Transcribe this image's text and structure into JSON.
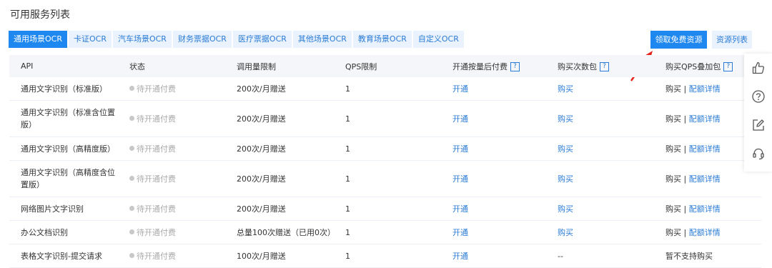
{
  "page": {
    "title": "可用服务列表"
  },
  "tabs": [
    "通用场景OCR",
    "卡证OCR",
    "汽车场景OCR",
    "财务票据OCR",
    "医疗票据OCR",
    "其他场景OCR",
    "教育场景OCR",
    "自定义OCR"
  ],
  "buttons": {
    "free_resources": "领取免费资源",
    "resource_list": "资源列表"
  },
  "table": {
    "headers": {
      "api": "API",
      "status": "状态",
      "quota": "调用量限制",
      "qps": "QPS限制",
      "pay_after": "开通按量后付费",
      "buy_pack": "购买次数包",
      "buy_qps": "购买QPS叠加包"
    },
    "help_mark": "?",
    "rows": [
      {
        "api": "通用文字识别（标准版）",
        "status": "待开通付费",
        "quota": "200次/月赠送",
        "qps": "1",
        "open": "开通",
        "buy": "购买",
        "buy_qps": "购买",
        "sep": "|",
        "detail": "配额详情"
      },
      {
        "api": "通用文字识别（标准含位置版）",
        "status": "待开通付费",
        "quota": "200次/月赠送",
        "qps": "1",
        "open": "开通",
        "buy": "购买",
        "buy_qps": "购买",
        "sep": "|",
        "detail": "配额详情"
      },
      {
        "api": "通用文字识别（高精度版）",
        "status": "待开通付费",
        "quota": "200次/月赠送",
        "qps": "1",
        "open": "开通",
        "buy": "购买",
        "buy_qps": "购买",
        "sep": "|",
        "detail": "配额详情"
      },
      {
        "api": "通用文字识别（高精度含位置版）",
        "status": "待开通付费",
        "quota": "200次/月赠送",
        "qps": "1",
        "open": "开通",
        "buy": "购买",
        "buy_qps": "购买",
        "sep": "|",
        "detail": "配额详情"
      },
      {
        "api": "网络图片文字识别",
        "status": "待开通付费",
        "quota": "200次/月赠送",
        "qps": "1",
        "open": "开通",
        "buy": "购买",
        "buy_qps": "购买",
        "sep": "|",
        "detail": "配额详情"
      },
      {
        "api": "办公文档识别",
        "status": "待开通付费",
        "quota": "总量100次赠送（已用0次）",
        "qps": "1",
        "open": "开通",
        "buy": "购买",
        "buy_qps": "购买",
        "sep": "|",
        "detail": "配额详情"
      },
      {
        "api": "表格文字识别-提交请求",
        "status": "待开通付费",
        "quota": "100次/月赠送",
        "qps": "1",
        "open": "开通",
        "buy": "--",
        "buy_qps": "暂不支持购买"
      }
    ]
  },
  "sidebar": [
    "thumbs-up-icon",
    "help-circle-icon",
    "edit-icon",
    "headset-icon"
  ],
  "colors": {
    "accent": "#1e87f0",
    "link": "#2b7bd6",
    "arrow": "#e8231d"
  }
}
